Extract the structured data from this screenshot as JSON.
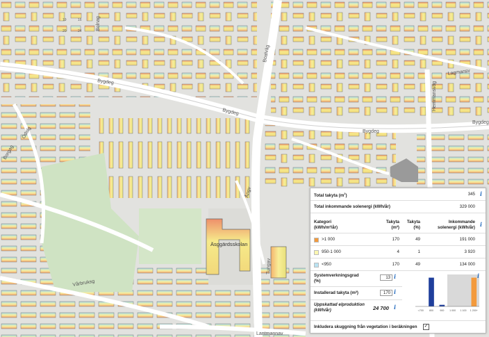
{
  "map": {
    "street_labels": {
      "bygdeg_west": "Bygdeg",
      "bygdeg_mid": "Bygdeg",
      "bygdeg_east": "Bygdeg",
      "bygdeg_far_east": "Bygdeg",
      "odalg": "Odalg",
      "borgag": "Borgag",
      "bolnag": "Bolnag",
      "bodag": "Boalväg",
      "lagmansv": "Lagmansv",
      "hemmansv": "Hemmansväg",
      "lantmannav": "Lantmannav",
      "varbruks": "Vårbruksg",
      "tunga": "Tungav",
      "ang": "Ångv",
      "school": "Äsggärdsskolan",
      "bd1": "20",
      "bd2": "24",
      "bd3": "19",
      "bd4": "16"
    }
  },
  "panel": {
    "total_roof_label": "Total takyta (m",
    "total_roof_sup": "2",
    "total_roof_close": ")",
    "total_roof_value": "345",
    "total_energy_label": "Total inkommande solenergi (kWh/år)",
    "total_energy_value": "329 000",
    "table": {
      "headers": {
        "category": "Kategori",
        "category_unit": "(kWh/m²/år)",
        "area": "Takyta",
        "area_unit": "(m²)",
        "pct": "Takyta",
        "pct_unit": "(%)",
        "incoming": "Inkommande",
        "incoming_unit": "solenergi (kWh/år)"
      },
      "rows": [
        {
          "label": ">1 000",
          "area": "170",
          "pct": "49",
          "energy": "191 000",
          "color": "#f39a3c"
        },
        {
          "label": "950-1 000",
          "area": "4",
          "pct": "1",
          "energy": "3 920",
          "color": "#fbf7b0"
        },
        {
          "label": "<950",
          "area": "170",
          "pct": "49",
          "energy": "134 000",
          "color": "#b9e2f2"
        }
      ]
    },
    "efficiency_label": "Systemverkningsgrad",
    "efficiency_unit": "(%)",
    "efficiency_value": "13",
    "installed_label": "Installerad takyta (m²)",
    "installed_value": "170",
    "production_label": "Uppskattad elproduktion",
    "production_unit": "(kWh/år)",
    "production_value": "24 700",
    "vegetation_label": "Inkludera skuggning från vegetation i beräkningen",
    "vegetation_checked": "✓",
    "info_glyph": "i",
    "chart_data": {
      "type": "bar",
      "categories": [
        "<700",
        "800",
        "900",
        "1 000",
        "1 100",
        "1 200+"
      ],
      "values": [
        0,
        0.9,
        0.05,
        0,
        0,
        0.9
      ],
      "bar_colors": [
        "#1f3f9c",
        "#1f3f9c",
        "#1f3f9c",
        "#f39a3c",
        "#f39a3c",
        "#f39a3c"
      ],
      "highlight_range": [
        "1 000",
        "1 200+"
      ]
    }
  }
}
